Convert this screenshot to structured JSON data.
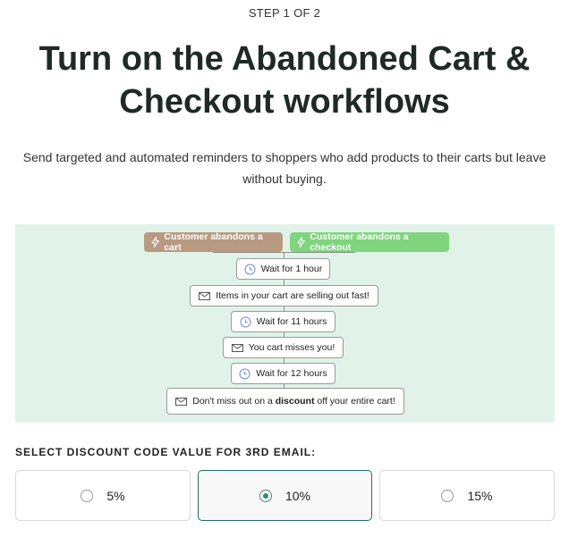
{
  "header": {
    "step": "STEP 1 OF 2",
    "title": "Turn on the Abandoned Cart & Checkout workflows",
    "subtitle": "Send targeted and automated reminders to shoppers who add products to their carts but leave without buying."
  },
  "workflow": {
    "triggers": [
      {
        "label": "Customer abandons a cart",
        "icon": "bolt-icon",
        "color": "#b89a82"
      },
      {
        "label": "Customer abandons a checkout",
        "icon": "bolt-icon",
        "color": "#7fd47d"
      }
    ],
    "steps": [
      {
        "type": "wait",
        "icon": "clock-icon",
        "label": "Wait for 1 hour"
      },
      {
        "type": "email",
        "icon": "email-icon",
        "label": "Items in your cart are selling out fast!"
      },
      {
        "type": "wait",
        "icon": "clock-icon",
        "label": "Wait for 11 hours"
      },
      {
        "type": "email",
        "icon": "email-icon",
        "label": "You cart misses you!"
      },
      {
        "type": "wait",
        "icon": "clock-icon",
        "label": "Wait for 12 hours"
      },
      {
        "type": "email",
        "icon": "email-icon",
        "label_before": "Don't miss out on a ",
        "label_bold": "discount",
        "label_after": " off your entire cart!"
      }
    ]
  },
  "discount": {
    "label": "SELECT DISCOUNT CODE VALUE FOR 3RD EMAIL:",
    "options": [
      {
        "label": "5%",
        "selected": false
      },
      {
        "label": "10%",
        "selected": true
      },
      {
        "label": "15%",
        "selected": false
      }
    ]
  },
  "colors": {
    "panel_bg": "#e1f3e9",
    "accent": "#2e8a76",
    "selected_border": "#1f6f5f"
  }
}
